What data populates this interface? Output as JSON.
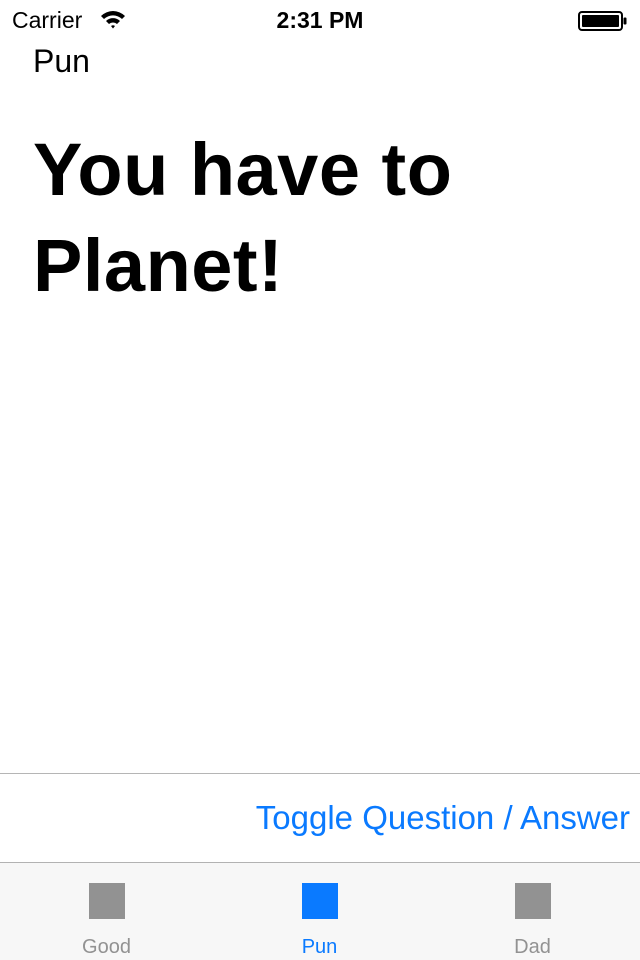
{
  "status_bar": {
    "carrier": "Carrier",
    "time": "2:31 PM",
    "icons": [
      "wifi-icon",
      "battery-icon"
    ]
  },
  "category_title": "Pun",
  "joke_text": "You have to Planet!",
  "toggle_label": "Toggle Question / Answer",
  "tabs": [
    {
      "label": "Good",
      "icon": "square-icon",
      "active": false
    },
    {
      "label": "Pun",
      "icon": "square-icon",
      "active": true
    },
    {
      "label": "Dad",
      "icon": "square-icon",
      "active": false
    }
  ],
  "colors": {
    "accent": "#0a7aff",
    "inactive": "#929292",
    "tab_bar_bg": "#f7f7f7"
  }
}
